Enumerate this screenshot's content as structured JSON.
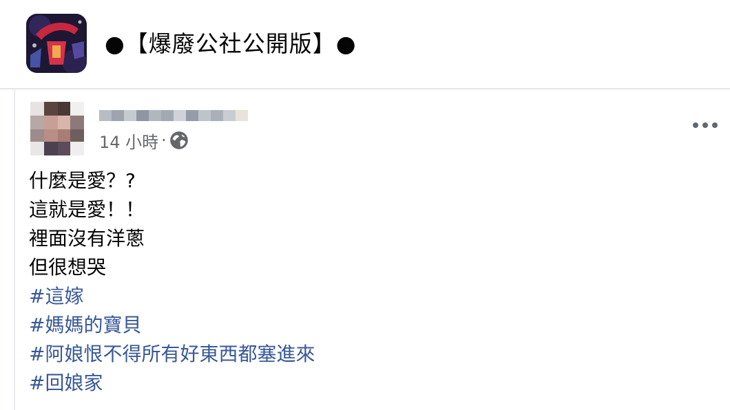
{
  "group": {
    "name": "●【爆廢公社公開版】●",
    "avatar_icon": "group-logo-icon"
  },
  "post": {
    "time": "14 小時",
    "separator": "·",
    "privacy_icon": "globe-icon",
    "menu_icon": "more-options-icon",
    "lines": [
      "什麼是愛？?",
      "這就是愛！！",
      "裡面沒有洋蔥",
      "但很想哭"
    ],
    "hashtags": [
      "#這嫁",
      "#媽媽的寶貝",
      "#阿娘恨不得所有好東西都塞進來",
      "#回娘家"
    ],
    "hashtag_color": "#385898",
    "meta_color": "#65676b"
  }
}
